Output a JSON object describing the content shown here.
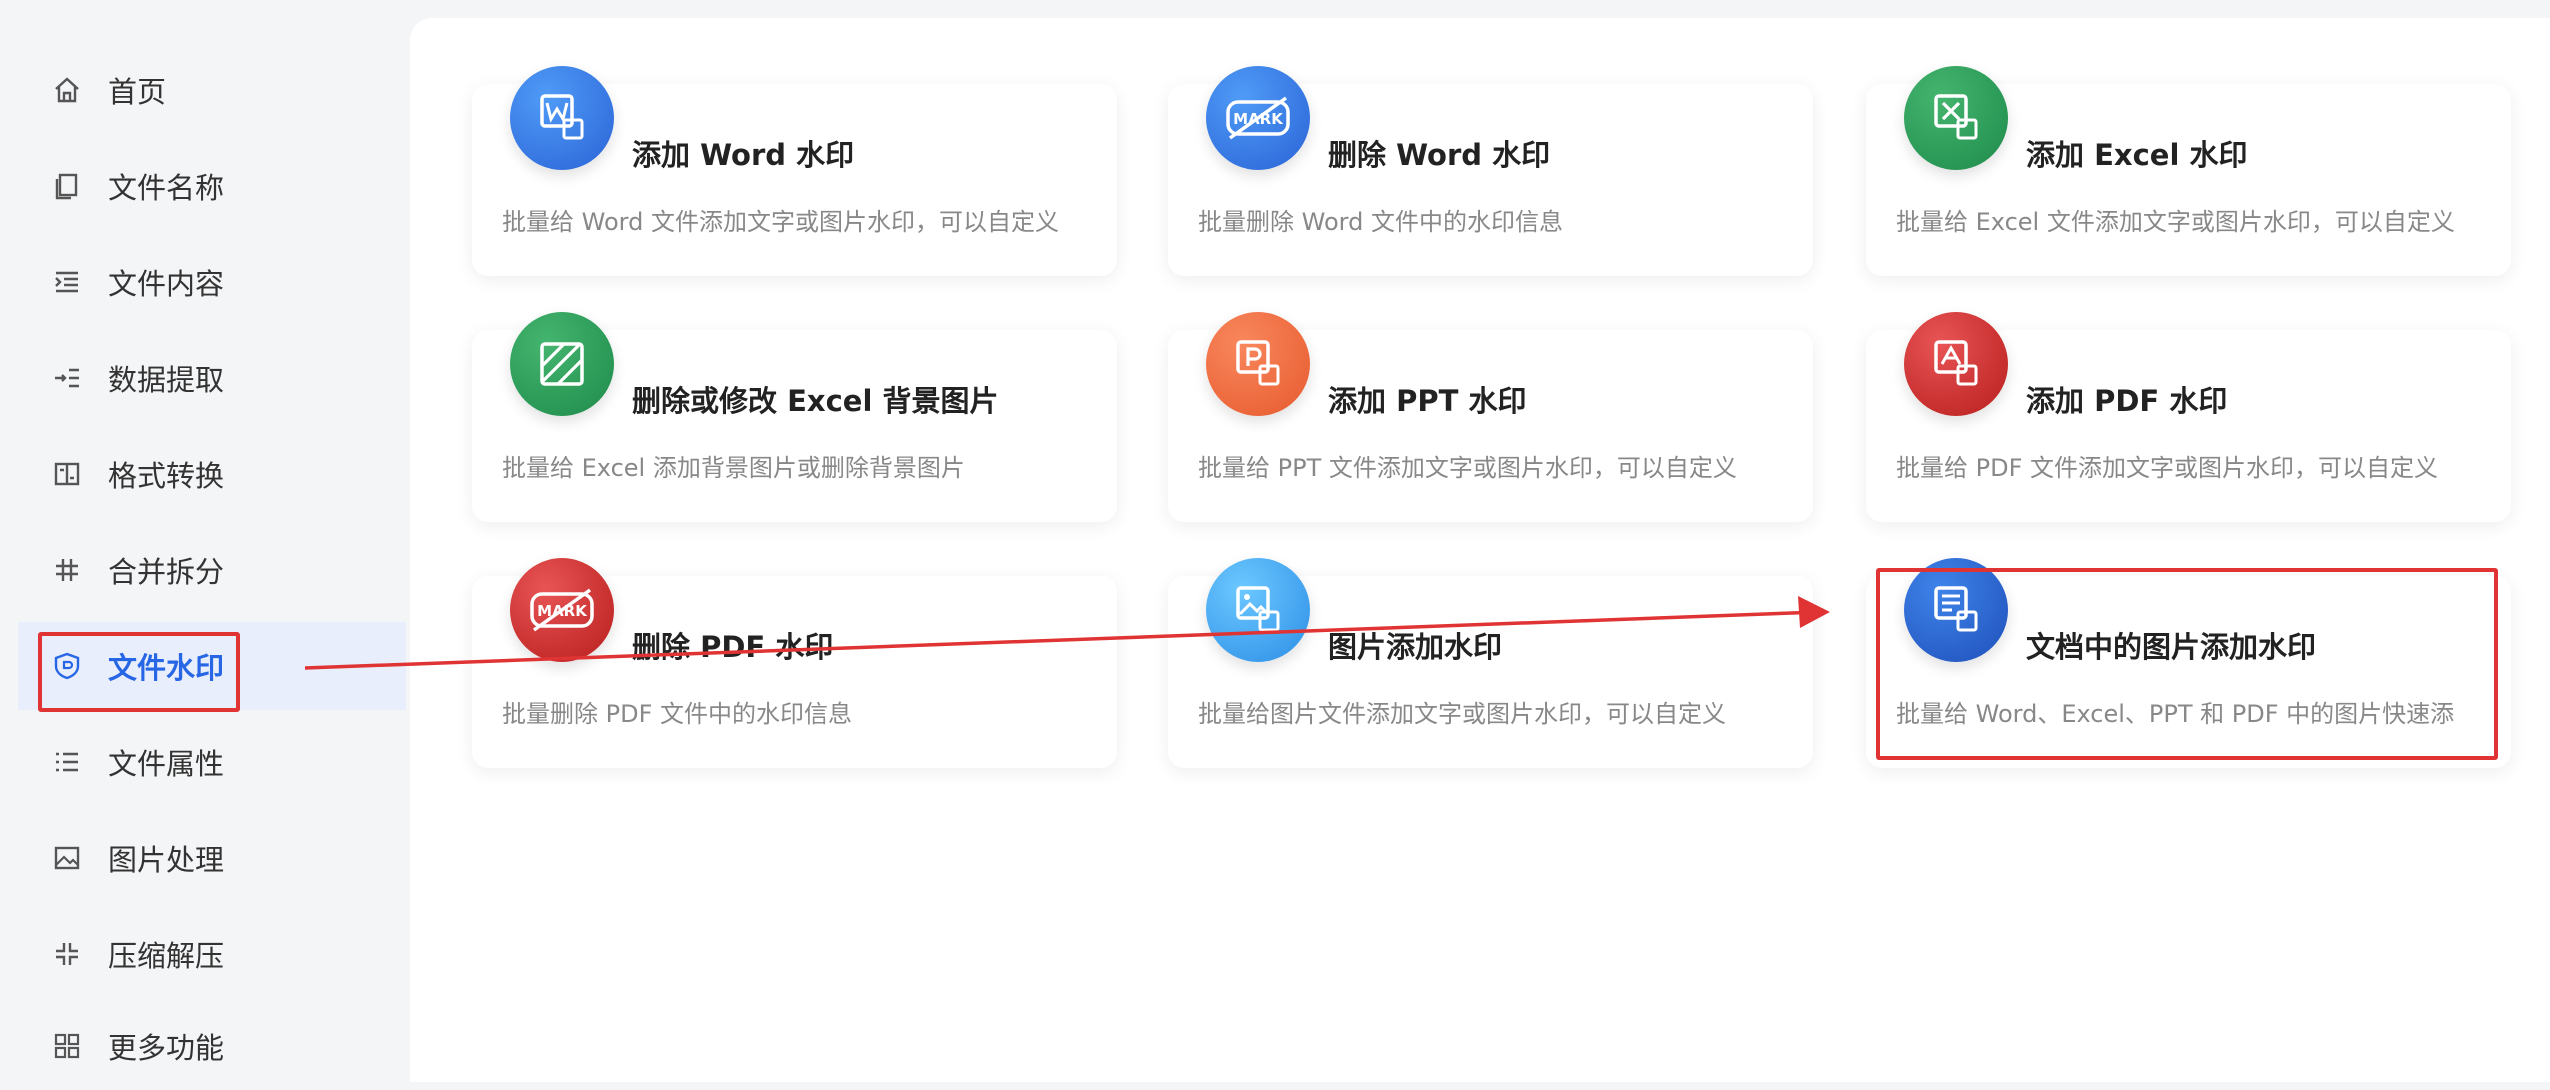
{
  "sidebar": {
    "items": [
      {
        "label": "首页",
        "icon": "home-icon"
      },
      {
        "label": "文件名称",
        "icon": "file-copy-icon"
      },
      {
        "label": "文件内容",
        "icon": "indent-list-icon"
      },
      {
        "label": "数据提取",
        "icon": "extract-icon"
      },
      {
        "label": "格式转换",
        "icon": "convert-icon"
      },
      {
        "label": "合并拆分",
        "icon": "hash-icon"
      },
      {
        "label": "文件水印",
        "icon": "shield-icon",
        "active": true
      },
      {
        "label": "文件属性",
        "icon": "list-icon"
      },
      {
        "label": "图片处理",
        "icon": "image-icon"
      },
      {
        "label": "压缩解压",
        "icon": "compress-icon"
      },
      {
        "label": "更多功能",
        "icon": "grid-icon"
      }
    ]
  },
  "cards": [
    {
      "title": "添加 Word 水印",
      "desc": "批量给 Word 文件添加文字或图片水印，可以自定义",
      "icon": "word-icon",
      "color": "#2a63d6"
    },
    {
      "title": "删除 Word 水印",
      "desc": "批量删除 Word 文件中的水印信息",
      "icon": "mark-remove-icon",
      "color": "#2a63d6"
    },
    {
      "title": "添加 Excel 水印",
      "desc": "批量给 Excel 文件添加文字或图片水印，可以自定义",
      "icon": "excel-icon",
      "color": "#1e8a4a"
    },
    {
      "title": "删除或修改 Excel 背景图片",
      "desc": "批量给 Excel 添加背景图片或删除背景图片",
      "icon": "excel-background-icon",
      "color": "#1e8a4a"
    },
    {
      "title": "添加 PPT 水印",
      "desc": "批量给 PPT 文件添加文字或图片水印，可以自定义",
      "icon": "ppt-icon",
      "color": "#e65a2d"
    },
    {
      "title": "添加 PDF 水印",
      "desc": "批量给 PDF 文件添加文字或图片水印，可以自定义",
      "icon": "pdf-icon",
      "color": "#b81d1d"
    },
    {
      "title": "删除 PDF 水印",
      "desc": "批量删除 PDF 文件中的水印信息",
      "icon": "mark-remove-icon",
      "color": "#b81d1d"
    },
    {
      "title": "图片添加水印",
      "desc": "批量给图片文件添加文字或图片水印，可以自定义",
      "icon": "image-icon",
      "color": "#2c8ee6"
    },
    {
      "title": "文档中的图片添加水印",
      "desc": "批量给 Word、Excel、PPT 和 PDF 中的图片快速添",
      "icon": "document-image-icon",
      "color": "#1f4fb9"
    }
  ],
  "colors": {
    "accent": "#2766e5",
    "highlight": "#e03434"
  }
}
